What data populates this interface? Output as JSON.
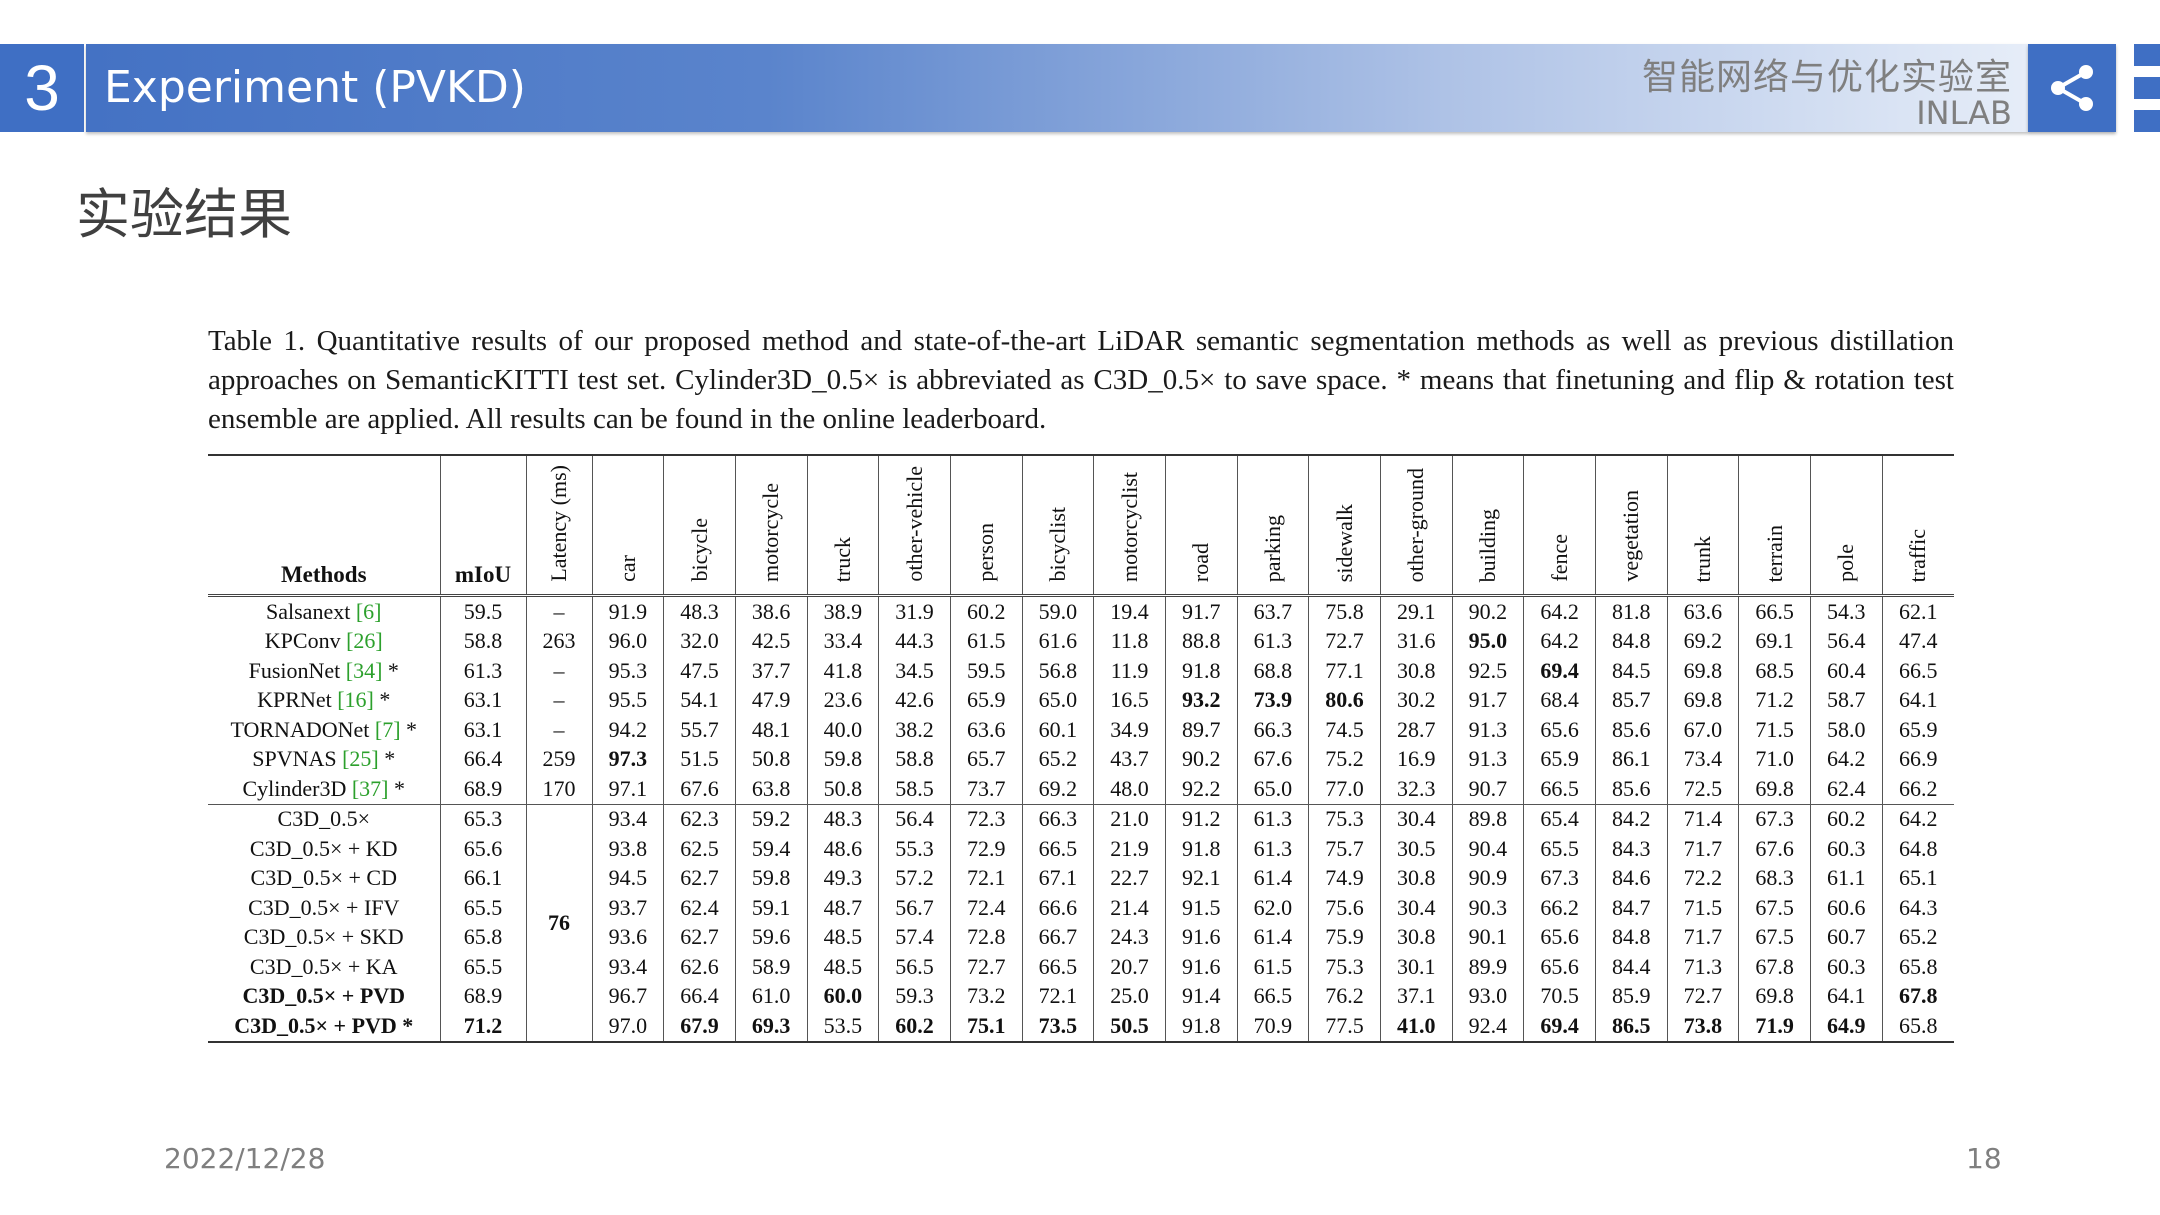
{
  "header": {
    "section_number": "3",
    "title": "Experiment (PVKD)",
    "brand_cn": "智能网络与优化实验室",
    "brand_en": "INLAB",
    "share_icon": "share-icon",
    "menu_icon": "menu-icon"
  },
  "subtitle": "实验结果",
  "caption": "Table 1.  Quantitative results of our proposed method and state-of-the-art LiDAR semantic segmentation methods as well as previous distillation approaches on SemanticKITTI test set. Cylinder3D_0.5× is abbreviated as C3D_0.5× to save space. * means that finetuning and flip & rotation test ensemble are applied. All results can be found in the online leaderboard.",
  "table": {
    "headers": [
      "Methods",
      "mIoU",
      "Latency (ms)",
      "car",
      "bicycle",
      "motorcycle",
      "truck",
      "other-vehicle",
      "person",
      "bicyclist",
      "motorcyclist",
      "road",
      "parking",
      "sidewalk",
      "other-ground",
      "building",
      "fence",
      "vegetation",
      "trunk",
      "terrain",
      "pole",
      "traffic"
    ],
    "rows": [
      {
        "method": "Salsanext",
        "cite": "[6]",
        "suffix": "",
        "miou": "59.5",
        "latency": "–",
        "values": [
          "91.9",
          "48.3",
          "38.6",
          "38.9",
          "31.9",
          "60.2",
          "59.0",
          "19.4",
          "91.7",
          "63.7",
          "75.8",
          "29.1",
          "90.2",
          "64.2",
          "81.8",
          "63.6",
          "66.5",
          "54.3",
          "62.1"
        ],
        "bold": []
      },
      {
        "method": "KPConv",
        "cite": "[26]",
        "suffix": "",
        "miou": "58.8",
        "latency": "263",
        "values": [
          "96.0",
          "32.0",
          "42.5",
          "33.4",
          "44.3",
          "61.5",
          "61.6",
          "11.8",
          "88.8",
          "61.3",
          "72.7",
          "31.6",
          "95.0",
          "64.2",
          "84.8",
          "69.2",
          "69.1",
          "56.4",
          "47.4"
        ],
        "bold": [
          12
        ]
      },
      {
        "method": "FusionNet",
        "cite": "[34]",
        "suffix": " *",
        "miou": "61.3",
        "latency": "–",
        "values": [
          "95.3",
          "47.5",
          "37.7",
          "41.8",
          "34.5",
          "59.5",
          "56.8",
          "11.9",
          "91.8",
          "68.8",
          "77.1",
          "30.8",
          "92.5",
          "69.4",
          "84.5",
          "69.8",
          "68.5",
          "60.4",
          "66.5"
        ],
        "bold": [
          13
        ]
      },
      {
        "method": "KPRNet",
        "cite": "[16]",
        "suffix": " *",
        "miou": "63.1",
        "latency": "–",
        "values": [
          "95.5",
          "54.1",
          "47.9",
          "23.6",
          "42.6",
          "65.9",
          "65.0",
          "16.5",
          "93.2",
          "73.9",
          "80.6",
          "30.2",
          "91.7",
          "68.4",
          "85.7",
          "69.8",
          "71.2",
          "58.7",
          "64.1"
        ],
        "bold": [
          8,
          9,
          10
        ]
      },
      {
        "method": "TORNADONet",
        "cite": "[7]",
        "suffix": " *",
        "miou": "63.1",
        "latency": "–",
        "values": [
          "94.2",
          "55.7",
          "48.1",
          "40.0",
          "38.2",
          "63.6",
          "60.1",
          "34.9",
          "89.7",
          "66.3",
          "74.5",
          "28.7",
          "91.3",
          "65.6",
          "85.6",
          "67.0",
          "71.5",
          "58.0",
          "65.9"
        ],
        "bold": []
      },
      {
        "method": "SPVNAS",
        "cite": "[25]",
        "suffix": " *",
        "miou": "66.4",
        "latency": "259",
        "values": [
          "97.3",
          "51.5",
          "50.8",
          "59.8",
          "58.8",
          "65.7",
          "65.2",
          "43.7",
          "90.2",
          "67.6",
          "75.2",
          "16.9",
          "91.3",
          "65.9",
          "86.1",
          "73.4",
          "71.0",
          "64.2",
          "66.9"
        ],
        "bold": [
          0
        ]
      },
      {
        "method": "Cylinder3D",
        "cite": "[37]",
        "suffix": " *",
        "miou": "68.9",
        "latency": "170",
        "values": [
          "97.1",
          "67.6",
          "63.8",
          "50.8",
          "58.5",
          "73.7",
          "69.2",
          "48.0",
          "92.2",
          "65.0",
          "77.0",
          "32.3",
          "90.7",
          "66.5",
          "85.6",
          "72.5",
          "69.8",
          "62.4",
          "66.2"
        ],
        "bold": []
      },
      {
        "method": "C3D_0.5×",
        "cite": "",
        "suffix": "",
        "miou": "65.3",
        "latency": "76",
        "values": [
          "93.4",
          "62.3",
          "59.2",
          "48.3",
          "56.4",
          "72.3",
          "66.3",
          "21.0",
          "91.2",
          "61.3",
          "75.3",
          "30.4",
          "89.8",
          "65.4",
          "84.2",
          "71.4",
          "67.3",
          "60.2",
          "64.2"
        ],
        "bold": []
      },
      {
        "method": "C3D_0.5× + KD",
        "cite": "",
        "suffix": "",
        "miou": "65.6",
        "latency": "",
        "values": [
          "93.8",
          "62.5",
          "59.4",
          "48.6",
          "55.3",
          "72.9",
          "66.5",
          "21.9",
          "91.8",
          "61.3",
          "75.7",
          "30.5",
          "90.4",
          "65.5",
          "84.3",
          "71.7",
          "67.6",
          "60.3",
          "64.8"
        ],
        "bold": []
      },
      {
        "method": "C3D_0.5× + CD",
        "cite": "",
        "suffix": "",
        "miou": "66.1",
        "latency": "",
        "values": [
          "94.5",
          "62.7",
          "59.8",
          "49.3",
          "57.2",
          "72.1",
          "67.1",
          "22.7",
          "92.1",
          "61.4",
          "74.9",
          "30.8",
          "90.9",
          "67.3",
          "84.6",
          "72.2",
          "68.3",
          "61.1",
          "65.1"
        ],
        "bold": []
      },
      {
        "method": "C3D_0.5× + IFV",
        "cite": "",
        "suffix": "",
        "miou": "65.5",
        "latency": "",
        "values": [
          "93.7",
          "62.4",
          "59.1",
          "48.7",
          "56.7",
          "72.4",
          "66.6",
          "21.4",
          "91.5",
          "62.0",
          "75.6",
          "30.4",
          "90.3",
          "66.2",
          "84.7",
          "71.5",
          "67.5",
          "60.6",
          "64.3"
        ],
        "bold": []
      },
      {
        "method": "C3D_0.5× + SKD",
        "cite": "",
        "suffix": "",
        "miou": "65.8",
        "latency": "",
        "values": [
          "93.6",
          "62.7",
          "59.6",
          "48.5",
          "57.4",
          "72.8",
          "66.7",
          "24.3",
          "91.6",
          "61.4",
          "75.9",
          "30.8",
          "90.1",
          "65.6",
          "84.8",
          "71.7",
          "67.5",
          "60.7",
          "65.2"
        ],
        "bold": []
      },
      {
        "method": "C3D_0.5× + KA",
        "cite": "",
        "suffix": "",
        "miou": "65.5",
        "latency": "",
        "values": [
          "93.4",
          "62.6",
          "58.9",
          "48.5",
          "56.5",
          "72.7",
          "66.5",
          "20.7",
          "91.6",
          "61.5",
          "75.3",
          "30.1",
          "89.9",
          "65.6",
          "84.4",
          "71.3",
          "67.8",
          "60.3",
          "65.8"
        ],
        "bold": []
      },
      {
        "method": "C3D_0.5× + PVD",
        "cite": "",
        "suffix": "",
        "miou": "68.9",
        "latency": "",
        "values": [
          "96.7",
          "66.4",
          "61.0",
          "60.0",
          "59.3",
          "73.2",
          "72.1",
          "25.0",
          "91.4",
          "66.5",
          "76.2",
          "37.1",
          "93.0",
          "70.5",
          "85.9",
          "72.7",
          "69.8",
          "64.1",
          "67.8"
        ],
        "bold": [
          3,
          18
        ],
        "rowbold": true
      },
      {
        "method": "C3D_0.5× + PVD",
        "cite": "",
        "suffix": " *",
        "miou": "71.2",
        "latency": "",
        "values": [
          "97.0",
          "67.9",
          "69.3",
          "53.5",
          "60.2",
          "75.1",
          "73.5",
          "50.5",
          "91.8",
          "70.9",
          "77.5",
          "41.0",
          "92.4",
          "69.4",
          "86.5",
          "73.8",
          "71.9",
          "64.9",
          "65.8"
        ],
        "bold": [
          1,
          2,
          4,
          5,
          6,
          7,
          11,
          13,
          14,
          15,
          16,
          17
        ],
        "rowbold": true,
        "miou_bold": true
      }
    ]
  },
  "footer": {
    "date": "2022/12/28",
    "page": "18"
  }
}
